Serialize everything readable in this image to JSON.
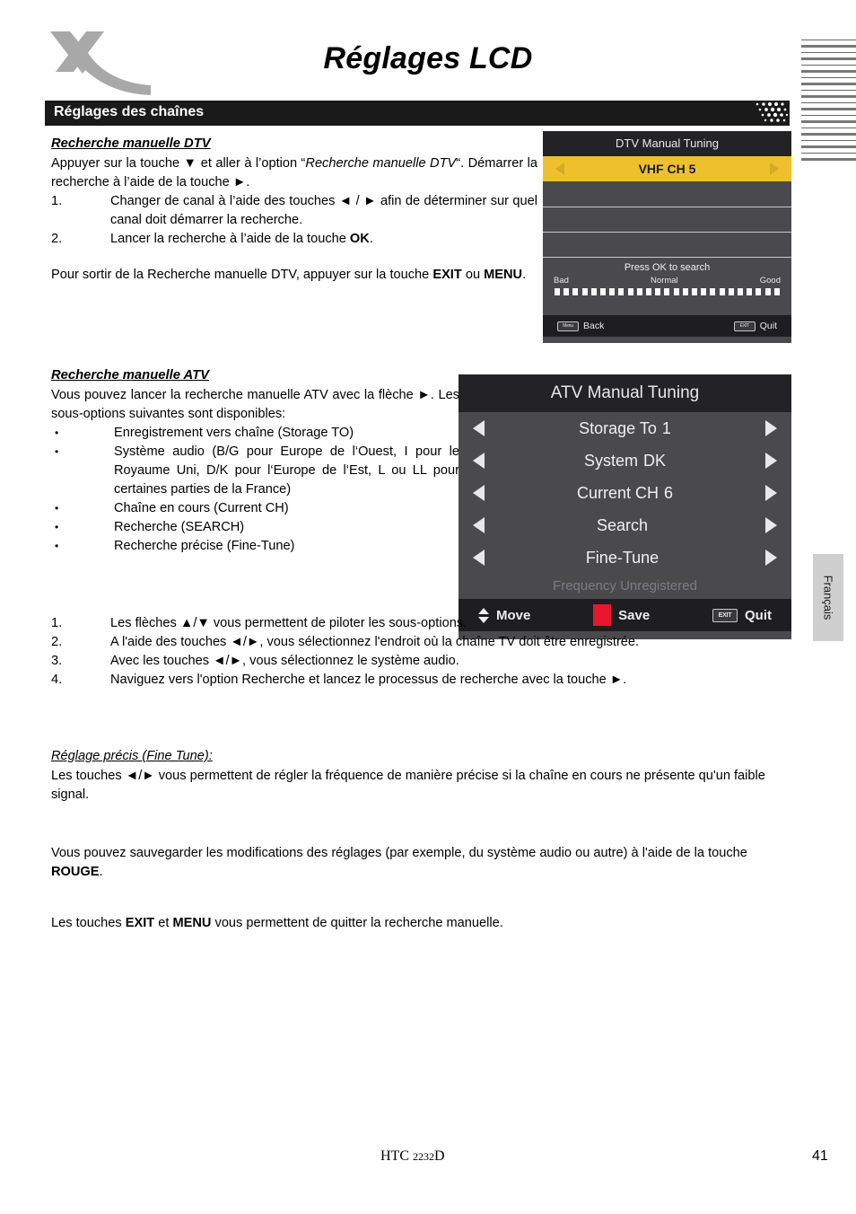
{
  "header": {
    "logo_name": "xoro-x-logo",
    "title": "Réglages LCD",
    "section_bar": "Réglages des chaînes"
  },
  "dtv_section": {
    "heading": "Recherche manuelle DTV",
    "intro_1": "Appuyer sur la touche ",
    "intro_arrow": "▼",
    "intro_2": " et aller à l’option “",
    "intro_italic": "Recherche manuelle DTV",
    "intro_3": "“. Démarrer la recherche à l’aide de la touche ►.",
    "steps": [
      {
        "marker": "1.",
        "text": "Changer de canal à l’aide des touches ◄ / ► afin de déterminer sur quel canal doit démarrer la recherche."
      },
      {
        "marker": "2.",
        "text_before": "Lancer la recherche à l’aide de la touche ",
        "bold": "OK",
        "text_after": "."
      }
    ],
    "exit_before": "Pour sortir de la Recherche manuelle DTV, appuyer sur la touche ",
    "exit_bold_1": "EXIT",
    "exit_mid": " ou ",
    "exit_bold_2": "MENU",
    "exit_after": "."
  },
  "atv_section": {
    "heading": "Recherche manuelle ATV",
    "intro": "Vous pouvez lancer la recherche manuelle ATV avec la flèche ►. Les sous-options suivantes sont disponibles:",
    "bullets": [
      "Enregistrement vers chaîne (Storage TO)",
      "Système audio (B/G pour Europe de l‘Ouest, I pour le Royaume Uni, D/K pour l‘Europe de l‘Est, L ou LL pour certaines parties de la France)",
      "Chaîne en cours (Current CH)",
      "Recherche (SEARCH)",
      "Recherche précise (Fine-Tune)"
    ],
    "steps": [
      {
        "marker": "1.",
        "text": "Les flèches ▲/▼ vous permettent de piloter les sous-options."
      },
      {
        "marker": "2.",
        "text": "A l'aide des touches ◄/►, vous  sélectionnez l'endroit où la chaîne TV doit être enregistrée."
      },
      {
        "marker": "3.",
        "text": "Avec les touches  ◄/►, vous sélectionnez le système audio."
      },
      {
        "marker": "4.",
        "text": "Naviguez vers l'option Recherche et lancez le processus de recherche avec la touche ►."
      }
    ]
  },
  "fine_tune_section": {
    "heading": "Réglage précis (Fine Tune):",
    "body": "Les touches ◄/► vous permettent de régler la fréquence de manière précise si la chaîne en cours ne présente qu'un faible signal."
  },
  "save_paragraph": {
    "before": "Vous pouvez sauvegarder les modifications des réglages (par exemple, du système audio ou autre) à l'aide de la touche ",
    "bold": "ROUGE",
    "after": "."
  },
  "exit_paragraph": {
    "before": "Les touches ",
    "bold_1": "EXIT",
    "mid": " et  ",
    "bold_2": "MENU",
    "after": " vous permettent de quitter la recherche manuelle."
  },
  "dtv_osd": {
    "title": "DTV Manual Tuning",
    "selected_row": {
      "left_arrow": "◄",
      "value": "VHF  CH 5",
      "right_arrow": "►"
    },
    "empty_rows": 3,
    "signal": {
      "hint": "Press OK to search",
      "label_bad": "Bad",
      "label_normal": "Normal",
      "label_good": "Good",
      "segments": 25
    },
    "footer": {
      "back_key": "Menu",
      "back_label": "Back",
      "quit_key": "EXIT",
      "quit_label": "Quit"
    },
    "colors": {
      "highlight": "#eec02e",
      "panel": "#4a4a4d",
      "title_bg": "#232326"
    }
  },
  "atv_osd": {
    "title": "ATV Manual Tuning",
    "rows": [
      {
        "label": "Storage To",
        "value": "1"
      },
      {
        "label": "System",
        "value": "DK"
      },
      {
        "label": "Current CH",
        "value": "6"
      },
      {
        "label": "Search",
        "value": ""
      },
      {
        "label": "Fine-Tune",
        "value": ""
      }
    ],
    "frequency_status": "Frequency Unregistered",
    "footer": {
      "move_label": "Move",
      "save_label": "Save",
      "quit_key": "EXIT",
      "quit_label": "Quit"
    },
    "colors": {
      "panel": "#4a4a4d",
      "title_bg": "#232326",
      "save_red": "#e8172f"
    }
  },
  "side_tab": {
    "label": "Français"
  },
  "footer": {
    "model_prefix": "HTC ",
    "model_number": "2232",
    "model_suffix": "D",
    "page_number": "41"
  }
}
